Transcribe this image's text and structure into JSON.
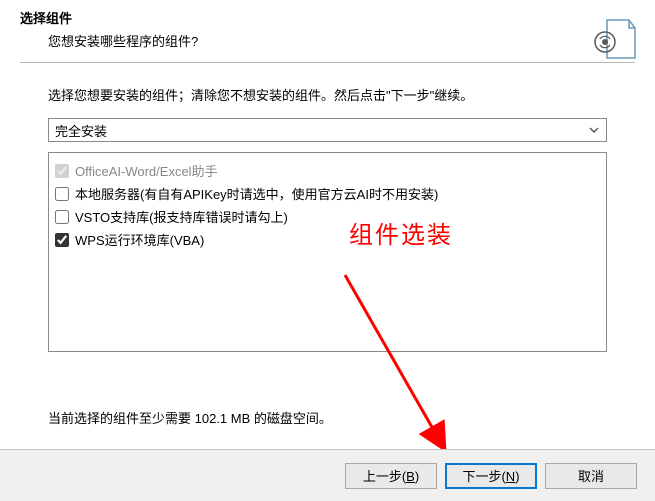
{
  "header": {
    "title": "选择组件",
    "subtitle": "您想安装哪些程序的组件?"
  },
  "desc": "选择您想要安装的组件；清除您不想安装的组件。然后点击\"下一步\"继续。",
  "dropdown": {
    "selected": "完全安装"
  },
  "components": [
    {
      "label": "OfficeAI-Word/Excel助手",
      "checked": true,
      "disabled": true
    },
    {
      "label": "本地服务器(有自有APIKey时请选中，使用官方云AI时不用安装)",
      "checked": false,
      "disabled": false
    },
    {
      "label": "VSTO支持库(报支持库错误时请勾上)",
      "checked": false,
      "disabled": false
    },
    {
      "label": "WPS运行环境库(VBA)",
      "checked": true,
      "disabled": false
    }
  ],
  "annotation": "组件选装",
  "disk": "当前选择的组件至少需要 102.1 MB 的磁盘空间。",
  "buttons": {
    "back": {
      "pre": "上一步(",
      "key": "B",
      "post": ")"
    },
    "next": {
      "pre": "下一步(",
      "key": "N",
      "post": ")"
    },
    "cancel": "取消"
  }
}
